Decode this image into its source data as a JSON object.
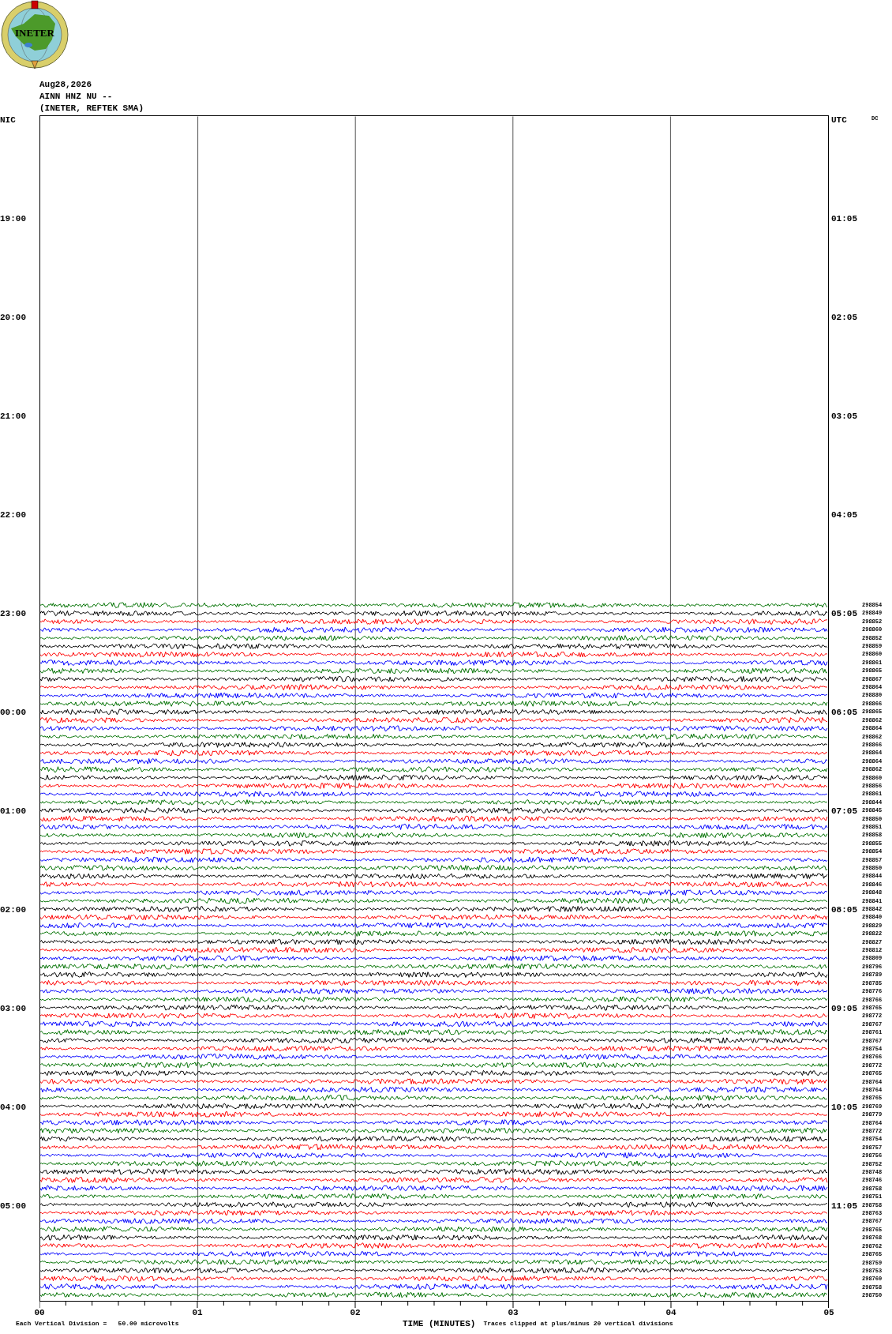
{
  "logo": {
    "text": "INETER"
  },
  "header": {
    "date": "Aug28,2026",
    "station": "AINN HNZ NU --",
    "network": "(INETER, REFTEK SMA)"
  },
  "left_axis": {
    "title": "NIC",
    "labels": [
      "19:00",
      "20:00",
      "21:00",
      "22:00",
      "23:00",
      "00:00",
      "01:00",
      "02:00",
      "03:00",
      "04:00",
      "05:00"
    ]
  },
  "right_axis": {
    "title": "UTC",
    "labels": [
      "01:05",
      "02:05",
      "03:05",
      "04:05",
      "05:05",
      "06:05",
      "07:05",
      "08:05",
      "09:05",
      "10:05",
      "11:05"
    ]
  },
  "corner_label": "DC",
  "traces": [
    {
      "label": "298854",
      "color": "#007000"
    },
    {
      "label": "298849",
      "color": "#000000"
    },
    {
      "label": "298852",
      "color": "#ff0000"
    },
    {
      "label": "298860",
      "color": "#0000ff"
    },
    {
      "label": "298852",
      "color": "#007000"
    },
    {
      "label": "298859",
      "color": "#000000"
    },
    {
      "label": "298860",
      "color": "#ff0000"
    },
    {
      "label": "298861",
      "color": "#0000ff"
    },
    {
      "label": "298865",
      "color": "#007000"
    },
    {
      "label": "298867",
      "color": "#000000"
    },
    {
      "label": "298864",
      "color": "#ff0000"
    },
    {
      "label": "298880",
      "color": "#0000ff"
    },
    {
      "label": "298866",
      "color": "#007000"
    },
    {
      "label": "298865",
      "color": "#000000"
    },
    {
      "label": "298862",
      "color": "#ff0000"
    },
    {
      "label": "298864",
      "color": "#0000ff"
    },
    {
      "label": "298862",
      "color": "#007000"
    },
    {
      "label": "298866",
      "color": "#000000"
    },
    {
      "label": "298864",
      "color": "#ff0000"
    },
    {
      "label": "298864",
      "color": "#0000ff"
    },
    {
      "label": "298862",
      "color": "#007000"
    },
    {
      "label": "298860",
      "color": "#000000"
    },
    {
      "label": "298856",
      "color": "#ff0000"
    },
    {
      "label": "298861",
      "color": "#0000ff"
    },
    {
      "label": "298844",
      "color": "#007000"
    },
    {
      "label": "298845",
      "color": "#000000"
    },
    {
      "label": "298850",
      "color": "#ff0000"
    },
    {
      "label": "298851",
      "color": "#0000ff"
    },
    {
      "label": "298858",
      "color": "#007000"
    },
    {
      "label": "298855",
      "color": "#000000"
    },
    {
      "label": "298854",
      "color": "#ff0000"
    },
    {
      "label": "298857",
      "color": "#0000ff"
    },
    {
      "label": "298850",
      "color": "#007000"
    },
    {
      "label": "298844",
      "color": "#000000"
    },
    {
      "label": "298846",
      "color": "#ff0000"
    },
    {
      "label": "298848",
      "color": "#0000ff"
    },
    {
      "label": "298841",
      "color": "#007000"
    },
    {
      "label": "298842",
      "color": "#000000"
    },
    {
      "label": "298840",
      "color": "#ff0000"
    },
    {
      "label": "298829",
      "color": "#0000ff"
    },
    {
      "label": "298822",
      "color": "#007000"
    },
    {
      "label": "298827",
      "color": "#000000"
    },
    {
      "label": "298812",
      "color": "#ff0000"
    },
    {
      "label": "298809",
      "color": "#0000ff"
    },
    {
      "label": "298796",
      "color": "#007000"
    },
    {
      "label": "298789",
      "color": "#000000"
    },
    {
      "label": "298785",
      "color": "#ff0000"
    },
    {
      "label": "298776",
      "color": "#0000ff"
    },
    {
      "label": "298766",
      "color": "#007000"
    },
    {
      "label": "298765",
      "color": "#000000"
    },
    {
      "label": "298772",
      "color": "#ff0000"
    },
    {
      "label": "298767",
      "color": "#0000ff"
    },
    {
      "label": "298761",
      "color": "#007000"
    },
    {
      "label": "298767",
      "color": "#000000"
    },
    {
      "label": "298754",
      "color": "#ff0000"
    },
    {
      "label": "298766",
      "color": "#0000ff"
    },
    {
      "label": "298772",
      "color": "#007000"
    },
    {
      "label": "298765",
      "color": "#000000"
    },
    {
      "label": "298764",
      "color": "#ff0000"
    },
    {
      "label": "298764",
      "color": "#0000ff"
    },
    {
      "label": "298765",
      "color": "#007000"
    },
    {
      "label": "298769",
      "color": "#000000"
    },
    {
      "label": "298779",
      "color": "#ff0000"
    },
    {
      "label": "298764",
      "color": "#0000ff"
    },
    {
      "label": "298772",
      "color": "#007000"
    },
    {
      "label": "298754",
      "color": "#000000"
    },
    {
      "label": "298757",
      "color": "#ff0000"
    },
    {
      "label": "298756",
      "color": "#0000ff"
    },
    {
      "label": "298752",
      "color": "#007000"
    },
    {
      "label": "298748",
      "color": "#000000"
    },
    {
      "label": "298746",
      "color": "#ff0000"
    },
    {
      "label": "298758",
      "color": "#0000ff"
    },
    {
      "label": "298751",
      "color": "#007000"
    },
    {
      "label": "298758",
      "color": "#000000"
    },
    {
      "label": "298763",
      "color": "#ff0000"
    },
    {
      "label": "298767",
      "color": "#0000ff"
    },
    {
      "label": "298765",
      "color": "#007000"
    },
    {
      "label": "298768",
      "color": "#000000"
    },
    {
      "label": "298762",
      "color": "#ff0000"
    },
    {
      "label": "298765",
      "color": "#0000ff"
    },
    {
      "label": "298759",
      "color": "#007000"
    },
    {
      "label": "298753",
      "color": "#000000"
    },
    {
      "label": "298760",
      "color": "#ff0000"
    },
    {
      "label": "298758",
      "color": "#0000ff"
    },
    {
      "label": "298750",
      "color": "#007000"
    }
  ],
  "x_axis": {
    "ticks": [
      "00",
      "01",
      "02",
      "03",
      "04",
      "05"
    ],
    "title": "TIME (MINUTES)"
  },
  "footer": {
    "scale_note": "Each Vertical Division =   50.00 microvolts",
    "clip_note": "Traces clipped at plus/minus 20 vertical divisions"
  }
}
